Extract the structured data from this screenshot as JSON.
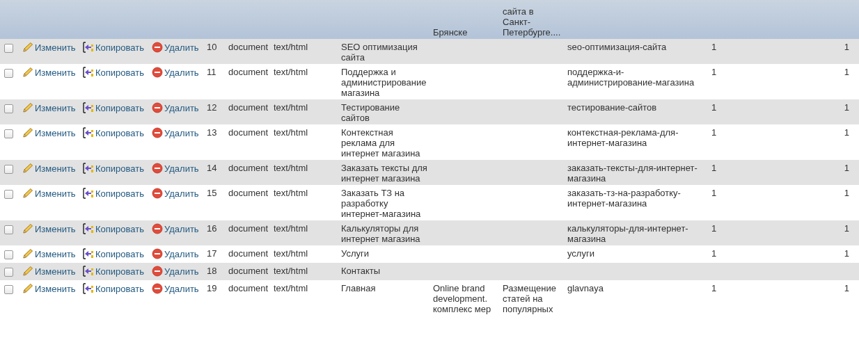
{
  "header": {
    "column_5": "Брянске",
    "column_6": "сайта в Санкт-Петербурге...."
  },
  "rows": [
    {
      "checked": false,
      "actions": [
        {
          "kind": "edit",
          "label": "Изменить"
        },
        {
          "kind": "copy",
          "label": "Копировать"
        },
        {
          "kind": "delete",
          "label": "Удалить"
        }
      ],
      "id": "10",
      "type": "document",
      "mime": "text/html",
      "title": "SEO оптимизация сайта",
      "alias": "seo-оптимизация-сайта",
      "column_11": "1",
      "column_12": "1"
    },
    {
      "checked": false,
      "actions": [
        {
          "kind": "edit",
          "label": "Изменить"
        },
        {
          "kind": "copy",
          "label": "Копировать"
        },
        {
          "kind": "delete",
          "label": "Удалить"
        }
      ],
      "id": "11",
      "type": "document",
      "mime": "text/html",
      "title": "Поддержка и администрирование магазина",
      "alias": "поддержка-и-администрирование-магазина",
      "column_11": "1",
      "column_12": "1"
    },
    {
      "checked": false,
      "actions": [
        {
          "kind": "edit",
          "label": "Изменить"
        },
        {
          "kind": "copy",
          "label": "Копировать"
        },
        {
          "kind": "delete",
          "label": "Удалить"
        }
      ],
      "id": "12",
      "type": "document",
      "mime": "text/html",
      "title": "Тестирование сайтов",
      "alias": "тестирование-сайтов",
      "column_11": "1",
      "column_12": "1"
    },
    {
      "checked": false,
      "actions": [
        {
          "kind": "edit",
          "label": "Изменить"
        },
        {
          "kind": "copy",
          "label": "Копировать"
        },
        {
          "kind": "delete",
          "label": "Удалить"
        }
      ],
      "id": "13",
      "type": "document",
      "mime": "text/html",
      "title": "Контекстная реклама для интернет магазина",
      "alias": "контекстная-реклама-для-интернет-магазина",
      "column_11": "1",
      "column_12": "1"
    },
    {
      "checked": false,
      "actions": [
        {
          "kind": "edit",
          "label": "Изменить"
        },
        {
          "kind": "copy",
          "label": "Копировать"
        },
        {
          "kind": "delete",
          "label": "Удалить"
        }
      ],
      "id": "14",
      "type": "document",
      "mime": "text/html",
      "title": "Заказать тексты для интернет магазина",
      "alias": "заказать-тексты-для-интернет-магазина",
      "column_11": "1",
      "column_12": "1"
    },
    {
      "checked": false,
      "actions": [
        {
          "kind": "edit",
          "label": "Изменить"
        },
        {
          "kind": "copy",
          "label": "Копировать"
        },
        {
          "kind": "delete",
          "label": "Удалить"
        }
      ],
      "id": "15",
      "type": "document",
      "mime": "text/html",
      "title": "Заказать ТЗ на разработку интернет-магазина",
      "alias": "заказать-тз-на-разработку-интернет-магазина",
      "column_11": "1",
      "column_12": "1"
    },
    {
      "checked": false,
      "actions": [
        {
          "kind": "edit",
          "label": "Изменить"
        },
        {
          "kind": "copy",
          "label": "Копировать"
        },
        {
          "kind": "delete",
          "label": "Удалить"
        }
      ],
      "id": "16",
      "type": "document",
      "mime": "text/html",
      "title": "Калькуляторы для интернет магазина",
      "alias": "калькуляторы-для-интернет-магазина",
      "column_11": "1",
      "column_12": "1"
    },
    {
      "checked": false,
      "actions": [
        {
          "kind": "edit",
          "label": "Изменить"
        },
        {
          "kind": "copy",
          "label": "Копировать"
        },
        {
          "kind": "delete",
          "label": "Удалить"
        }
      ],
      "id": "17",
      "type": "document",
      "mime": "text/html",
      "title": "Услуги",
      "alias": "услуги",
      "column_11": "1",
      "column_12": "1"
    },
    {
      "checked": false,
      "actions": [
        {
          "kind": "edit",
          "label": "Изменить"
        },
        {
          "kind": "copy",
          "label": "Копировать"
        },
        {
          "kind": "delete",
          "label": "Удалить"
        }
      ],
      "id": "18",
      "type": "document",
      "mime": "text/html",
      "title": "Контакты"
    },
    {
      "checked": false,
      "actions": [
        {
          "kind": "edit",
          "label": "Изменить"
        },
        {
          "kind": "copy",
          "label": "Копировать"
        },
        {
          "kind": "delete",
          "label": "Удалить"
        }
      ],
      "id": "19",
      "type": "document",
      "mime": "text/html",
      "title": "Главная",
      "column_5": "Online brand development. комплекс мер",
      "column_6": "Размещение статей на популярных",
      "alias": "glavnaya",
      "column_11": "1",
      "column_12": "1"
    }
  ]
}
